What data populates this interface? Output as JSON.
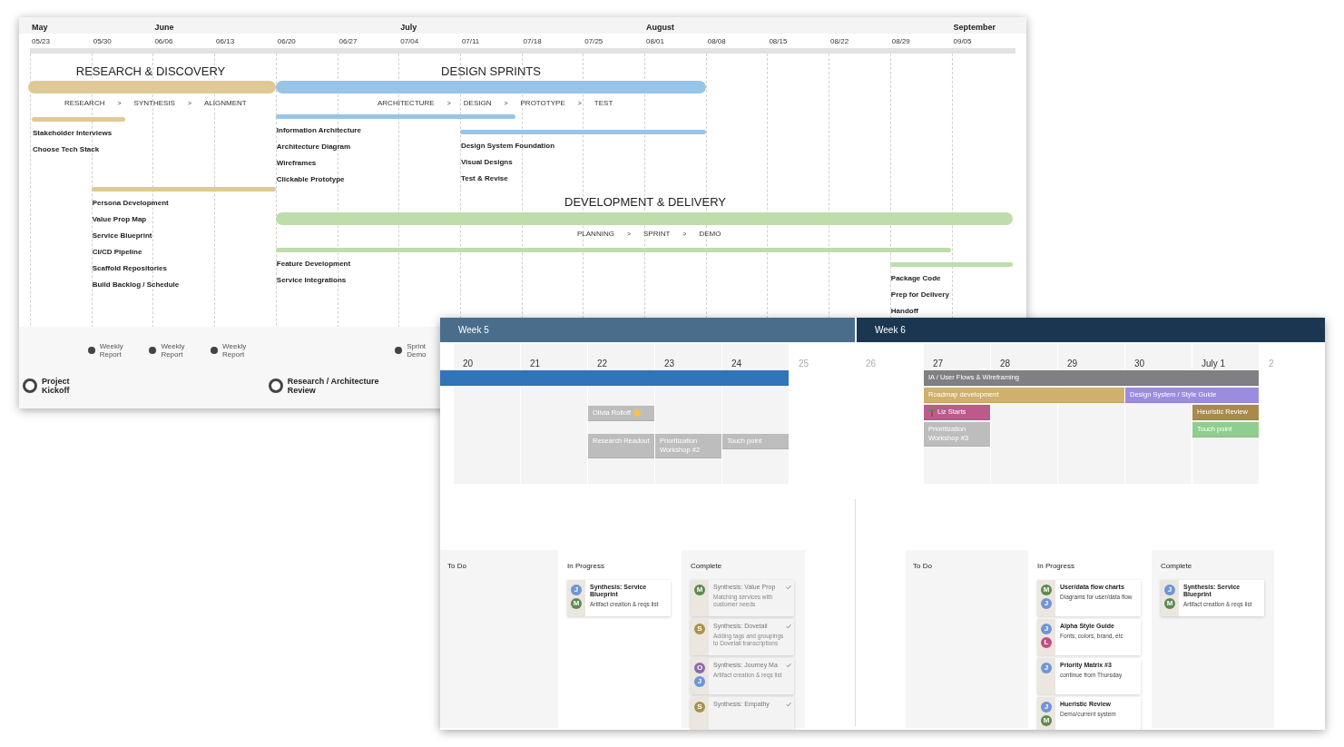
{
  "timeline": {
    "months": [
      "May",
      "June",
      "July",
      "August",
      "September"
    ],
    "weeks": [
      "05/23",
      "05/30",
      "06/06",
      "06/13",
      "06/20",
      "06/27",
      "07/04",
      "07/11",
      "07/18",
      "07/25",
      "08/01",
      "08/08",
      "08/15",
      "08/22",
      "08/29",
      "09/05"
    ],
    "phases": [
      {
        "title": "RESEARCH & DISCOVERY",
        "color": "#dfc997",
        "separator": ">",
        "steps": [
          "RESEARCH",
          "SYNTHESIS",
          "ALIGNMENT"
        ],
        "tracks": [
          {
            "items": [
              "Stakeholder Interviews",
              "Choose Tech Stack"
            ]
          },
          {
            "items": [
              "Persona Development",
              "Value Prop Map",
              "Service Blueprint",
              "CI/CD Pipeline",
              "Scaffold Repositories",
              "Build Backlog / Schedule"
            ]
          }
        ]
      },
      {
        "title": "DESIGN SPRINTS",
        "color": "#98c4e8",
        "separator": ">",
        "steps": [
          "ARCHITECTURE",
          "DESIGN",
          "PROTOTYPE",
          "TEST"
        ],
        "tracks": [
          {
            "items": [
              "Information Architecture",
              "Architecture Diagram",
              "Wireframes",
              "Clickable Prototype"
            ]
          },
          {
            "items": [
              "Design System Foundation",
              "Visual Designs",
              "Test & Revise"
            ]
          }
        ]
      },
      {
        "title": "DEVELOPMENT & DELIVERY",
        "color": "#bfdcab",
        "separator": ">",
        "steps": [
          "PLANNING",
          "SPRINT",
          "DEMO"
        ],
        "tracks": [
          {
            "items": [
              "Feature Development",
              "Service Integrations"
            ]
          },
          {
            "items": [
              "Package Code",
              "Prep for Delivery",
              "Handoff"
            ]
          }
        ]
      }
    ],
    "milestones": [
      {
        "label": "Project Kickoff",
        "kind": "major"
      },
      {
        "label": "Weekly Report",
        "kind": "minor"
      },
      {
        "label": "Weekly Report",
        "kind": "minor"
      },
      {
        "label": "Weekly Report",
        "kind": "minor"
      },
      {
        "label": "Research / Architecture Review",
        "kind": "major"
      },
      {
        "label": "Sprint Demo",
        "kind": "minor"
      }
    ]
  },
  "calendar": {
    "weeks": [
      {
        "label": "Week 5"
      },
      {
        "label": "Week 6"
      }
    ],
    "days": [
      {
        "label": "20",
        "weekend": false
      },
      {
        "label": "21",
        "weekend": false
      },
      {
        "label": "22",
        "weekend": false
      },
      {
        "label": "23",
        "weekend": false
      },
      {
        "label": "24",
        "weekend": false
      },
      {
        "label": "25",
        "weekend": true
      },
      {
        "label": "26",
        "weekend": true
      },
      {
        "label": "27",
        "weekend": false
      },
      {
        "label": "28",
        "weekend": false
      },
      {
        "label": "29",
        "weekend": false
      },
      {
        "label": "30",
        "weekend": false
      },
      {
        "label": "July 1",
        "weekend": false
      },
      {
        "label": "2",
        "weekend": true
      }
    ],
    "events": [
      {
        "color": "#3174b8"
      },
      {
        "label": "IA / User Flows & Wireframing",
        "color": "#808084"
      },
      {
        "label": "Roadmap development",
        "color": "#cfb06c"
      },
      {
        "label": "Design System / Style Guide",
        "color": "#9b8ce0"
      },
      {
        "label": "Liz Starts",
        "color": "#bd5a8c",
        "kind": "palm"
      },
      {
        "label": "Heuristic Review",
        "color": "#a88a4c"
      },
      {
        "label": "Touch point",
        "color": "#8fce8f"
      },
      {
        "label": "Prioritization Workshop #3",
        "color": "#bdbdbd"
      },
      {
        "label": "Olivia Rolloff",
        "color": "#bdbdbd",
        "kind": "emoji"
      },
      {
        "label": "Research Readout",
        "color": "#bdbdbd"
      },
      {
        "label": "Prioritization Workshop #2",
        "color": "#bdbdbd"
      },
      {
        "label": "Touch point",
        "color": "#bdbdbd"
      }
    ]
  },
  "boards": [
    {
      "columns": [
        {
          "title": "To Do"
        },
        {
          "title": "In Progress",
          "cards": [
            {
              "title": "Synthesis: Service Blueprint",
              "subtitle": "Artifact creation & reqs list",
              "done": false,
              "avatars": [
                {
                  "initial": "J",
                  "color": "#6f95d6"
                },
                {
                  "initial": "M",
                  "color": "#5e8a4f"
                }
              ]
            }
          ]
        },
        {
          "title": "Complete",
          "cards": [
            {
              "title": "Synthesis: Value Prop",
              "subtitle": "Matching services with customer needs",
              "done": true,
              "avatars": [
                {
                  "initial": "M",
                  "color": "#5e8a4f"
                }
              ]
            },
            {
              "title": "Synthesis: Dovetail",
              "subtitle": "Adding tags and groupings to Dovetail transcriptions",
              "done": true,
              "avatars": [
                {
                  "initial": "S",
                  "color": "#a8934e"
                }
              ]
            },
            {
              "title": "Synthesis: Journey Ma",
              "subtitle": "Artifact creation & reqs list",
              "done": true,
              "avatars": [
                {
                  "initial": "O",
                  "color": "#8e6aa8"
                },
                {
                  "initial": "J",
                  "color": "#6f95d6"
                }
              ]
            },
            {
              "title": "Synthesis: Empathy",
              "done": true,
              "avatars": [
                {
                  "initial": "S",
                  "color": "#a8934e"
                }
              ]
            }
          ]
        }
      ]
    },
    {
      "columns": [
        {
          "title": "To Do"
        },
        {
          "title": "In Progress",
          "cards": [
            {
              "title": "User/data flow charts",
              "subtitle": "Diagrams for user/data flow",
              "done": false,
              "avatars": [
                {
                  "initial": "M",
                  "color": "#5e8a4f"
                },
                {
                  "initial": "J",
                  "color": "#6f95d6"
                }
              ]
            },
            {
              "title": "Alpha Style Guide",
              "subtitle": "Fonts, colors, brand, etc",
              "done": false,
              "avatars": [
                {
                  "initial": "J",
                  "color": "#6f95d6"
                },
                {
                  "initial": "L",
                  "color": "#c05086"
                }
              ]
            },
            {
              "title": "Priority Matrix #3",
              "subtitle": "continue from Thursday",
              "done": false,
              "avatars": [
                {
                  "initial": "J",
                  "color": "#6f95d6"
                }
              ]
            },
            {
              "title": "Hueristic Review",
              "subtitle": "Demo/current system",
              "done": false,
              "avatars": [
                {
                  "initial": "J",
                  "color": "#6f95d6"
                },
                {
                  "initial": "M",
                  "color": "#5e8a4f"
                }
              ]
            }
          ]
        },
        {
          "title": "Complete",
          "cards": [
            {
              "title": "Synthesis: Service Blueprint",
              "subtitle": "Artifact creation & reqs list",
              "done": false,
              "avatars": [
                {
                  "initial": "J",
                  "color": "#6f95d6"
                },
                {
                  "initial": "M",
                  "color": "#5e8a4f"
                }
              ]
            }
          ]
        }
      ]
    }
  ]
}
